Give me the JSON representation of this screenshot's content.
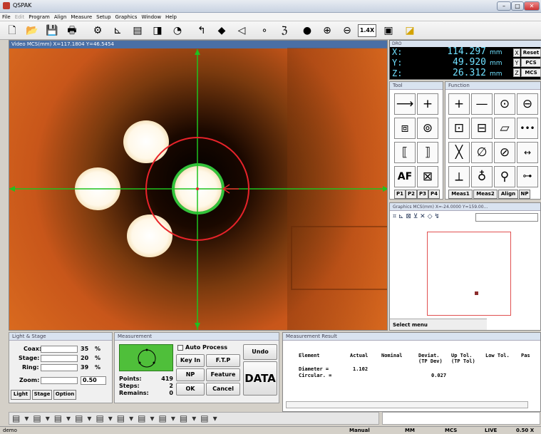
{
  "app": {
    "title": "QSPAK"
  },
  "menu": [
    "File",
    "Edit",
    "Program",
    "Align",
    "Measure",
    "Setup",
    "Graphics",
    "Window",
    "Help"
  ],
  "toolbar": {
    "zoom_label": "1.4X"
  },
  "video": {
    "header": "Video  MCS(mm) X=117.1804 Y=46.5454"
  },
  "dro": {
    "header": "DRO",
    "x_label": "X:",
    "x_value": "114.297",
    "x_unit": "mm",
    "y_label": "Y:",
    "y_value": "49.920",
    "y_unit": "mm",
    "z_label": "Z:",
    "z_value": "26.312",
    "z_unit": "mm",
    "x_btn": "X",
    "y_btn": "Y",
    "z_btn": "Z",
    "reset": "Reset",
    "pcs": "PCS",
    "mcs": "MCS"
  },
  "tool_panel": {
    "title": "Tool",
    "tabs": [
      "P1",
      "P2",
      "P3",
      "P4"
    ],
    "af_label": "AF"
  },
  "function_panel": {
    "title": "Function",
    "tabs": [
      "Meas1",
      "Meas2",
      "Align",
      "NP"
    ]
  },
  "graphics": {
    "header": "Graphics  MCS(mm) X=-24.0000 Y=159.00...",
    "select_menu": "Select menu"
  },
  "light": {
    "title": "Light & Stage",
    "coax_label": "Coax:",
    "coax_value": "35",
    "coax_unit": "%",
    "stage_label": "Stage:",
    "stage_value": "20",
    "stage_unit": "%",
    "ring_label": "Ring:",
    "ring_value": "39",
    "ring_unit": "%",
    "zoom_label": "Zoom:",
    "zoom_value": "0.50",
    "tabs": [
      "Light",
      "Stage",
      "Option"
    ]
  },
  "measurement": {
    "title": "Measurement",
    "auto_process": "Auto Process",
    "points_label": "Points:",
    "points_value": "419",
    "steps_label": "Steps:",
    "steps_value": "2",
    "remains_label": "Remains:",
    "remains_value": "0",
    "key_in": "Key In",
    "ftp": "F.T.P",
    "np": "NP",
    "feature": "Feature",
    "ok": "OK",
    "cancel": "Cancel",
    "undo": "Undo",
    "data": "DATA"
  },
  "result": {
    "title": "Measurement Result",
    "headers": [
      "Element",
      "Actual",
      "Nominal",
      "Deviat.\n(TP Dev)",
      "Up Tol.\n(TP Tol)",
      "Low Tol.",
      "Pas"
    ],
    "rows": [
      {
        "element": "Diameter =",
        "actual": "1.102",
        "nominal": "",
        "deviat": "",
        "up": "",
        "low": ""
      },
      {
        "element": "Circular. =",
        "actual": "",
        "nominal": "",
        "deviat": "0.027",
        "up": "",
        "low": ""
      }
    ]
  },
  "status": {
    "left": "demo",
    "mode": "Manual",
    "units": "MM",
    "coord": "MCS",
    "live": "LIVE",
    "zoom": "0.50 X"
  },
  "colors": {
    "crosshair": "#1fc21f",
    "circle": "#e8232a",
    "accent_header": "#4a6fa5"
  }
}
